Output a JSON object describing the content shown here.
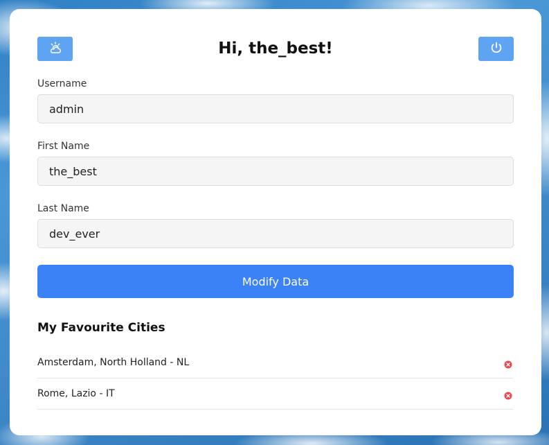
{
  "header": {
    "title": "Hi, the_best!",
    "left_icon": "weather-icon",
    "right_icon": "power-icon"
  },
  "form": {
    "username": {
      "label": "Username",
      "value": "admin"
    },
    "first_name": {
      "label": "First Name",
      "value": "the_best"
    },
    "last_name": {
      "label": "Last Name",
      "value": "dev_ever"
    },
    "submit_label": "Modify Data"
  },
  "favourites": {
    "title": "My Favourite Cities",
    "items": [
      {
        "label": "Amsterdam, North Holland - NL"
      },
      {
        "label": "Rome, Lazio - IT"
      }
    ]
  },
  "colors": {
    "accent": "#3b82f6",
    "icon_button": "#5fa4f3",
    "remove": "#e5484d"
  }
}
